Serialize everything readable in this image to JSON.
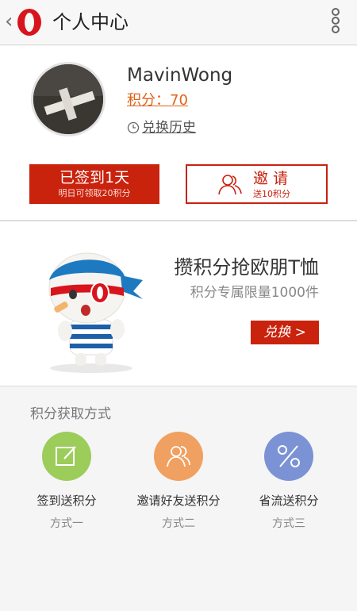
{
  "header": {
    "title": "个人中心"
  },
  "profile": {
    "username": "MavinWong",
    "points": "积分：70",
    "history_label": "兑换历史"
  },
  "checkin": {
    "label": "已签到1天",
    "sub": "明日可领取20积分"
  },
  "invite": {
    "label": "邀 请",
    "sub": "送10积分"
  },
  "banner": {
    "title": "攒积分抢欧朋T恤",
    "subtitle": "积分专属限量1000件",
    "button": "兑换 >"
  },
  "methods": {
    "title": "积分获取方式",
    "items": [
      {
        "label": "签到送积分",
        "sub": "方式一",
        "color": "#9ccc5a",
        "icon": "edit-icon"
      },
      {
        "label": "邀请好友送积分",
        "sub": "方式二",
        "color": "#f0a060",
        "icon": "people-icon"
      },
      {
        "label": "省流送积分",
        "sub": "方式三",
        "color": "#7b93d4",
        "icon": "percent-icon"
      }
    ]
  },
  "colors": {
    "accent": "#c9220d",
    "points": "#e0621a"
  }
}
